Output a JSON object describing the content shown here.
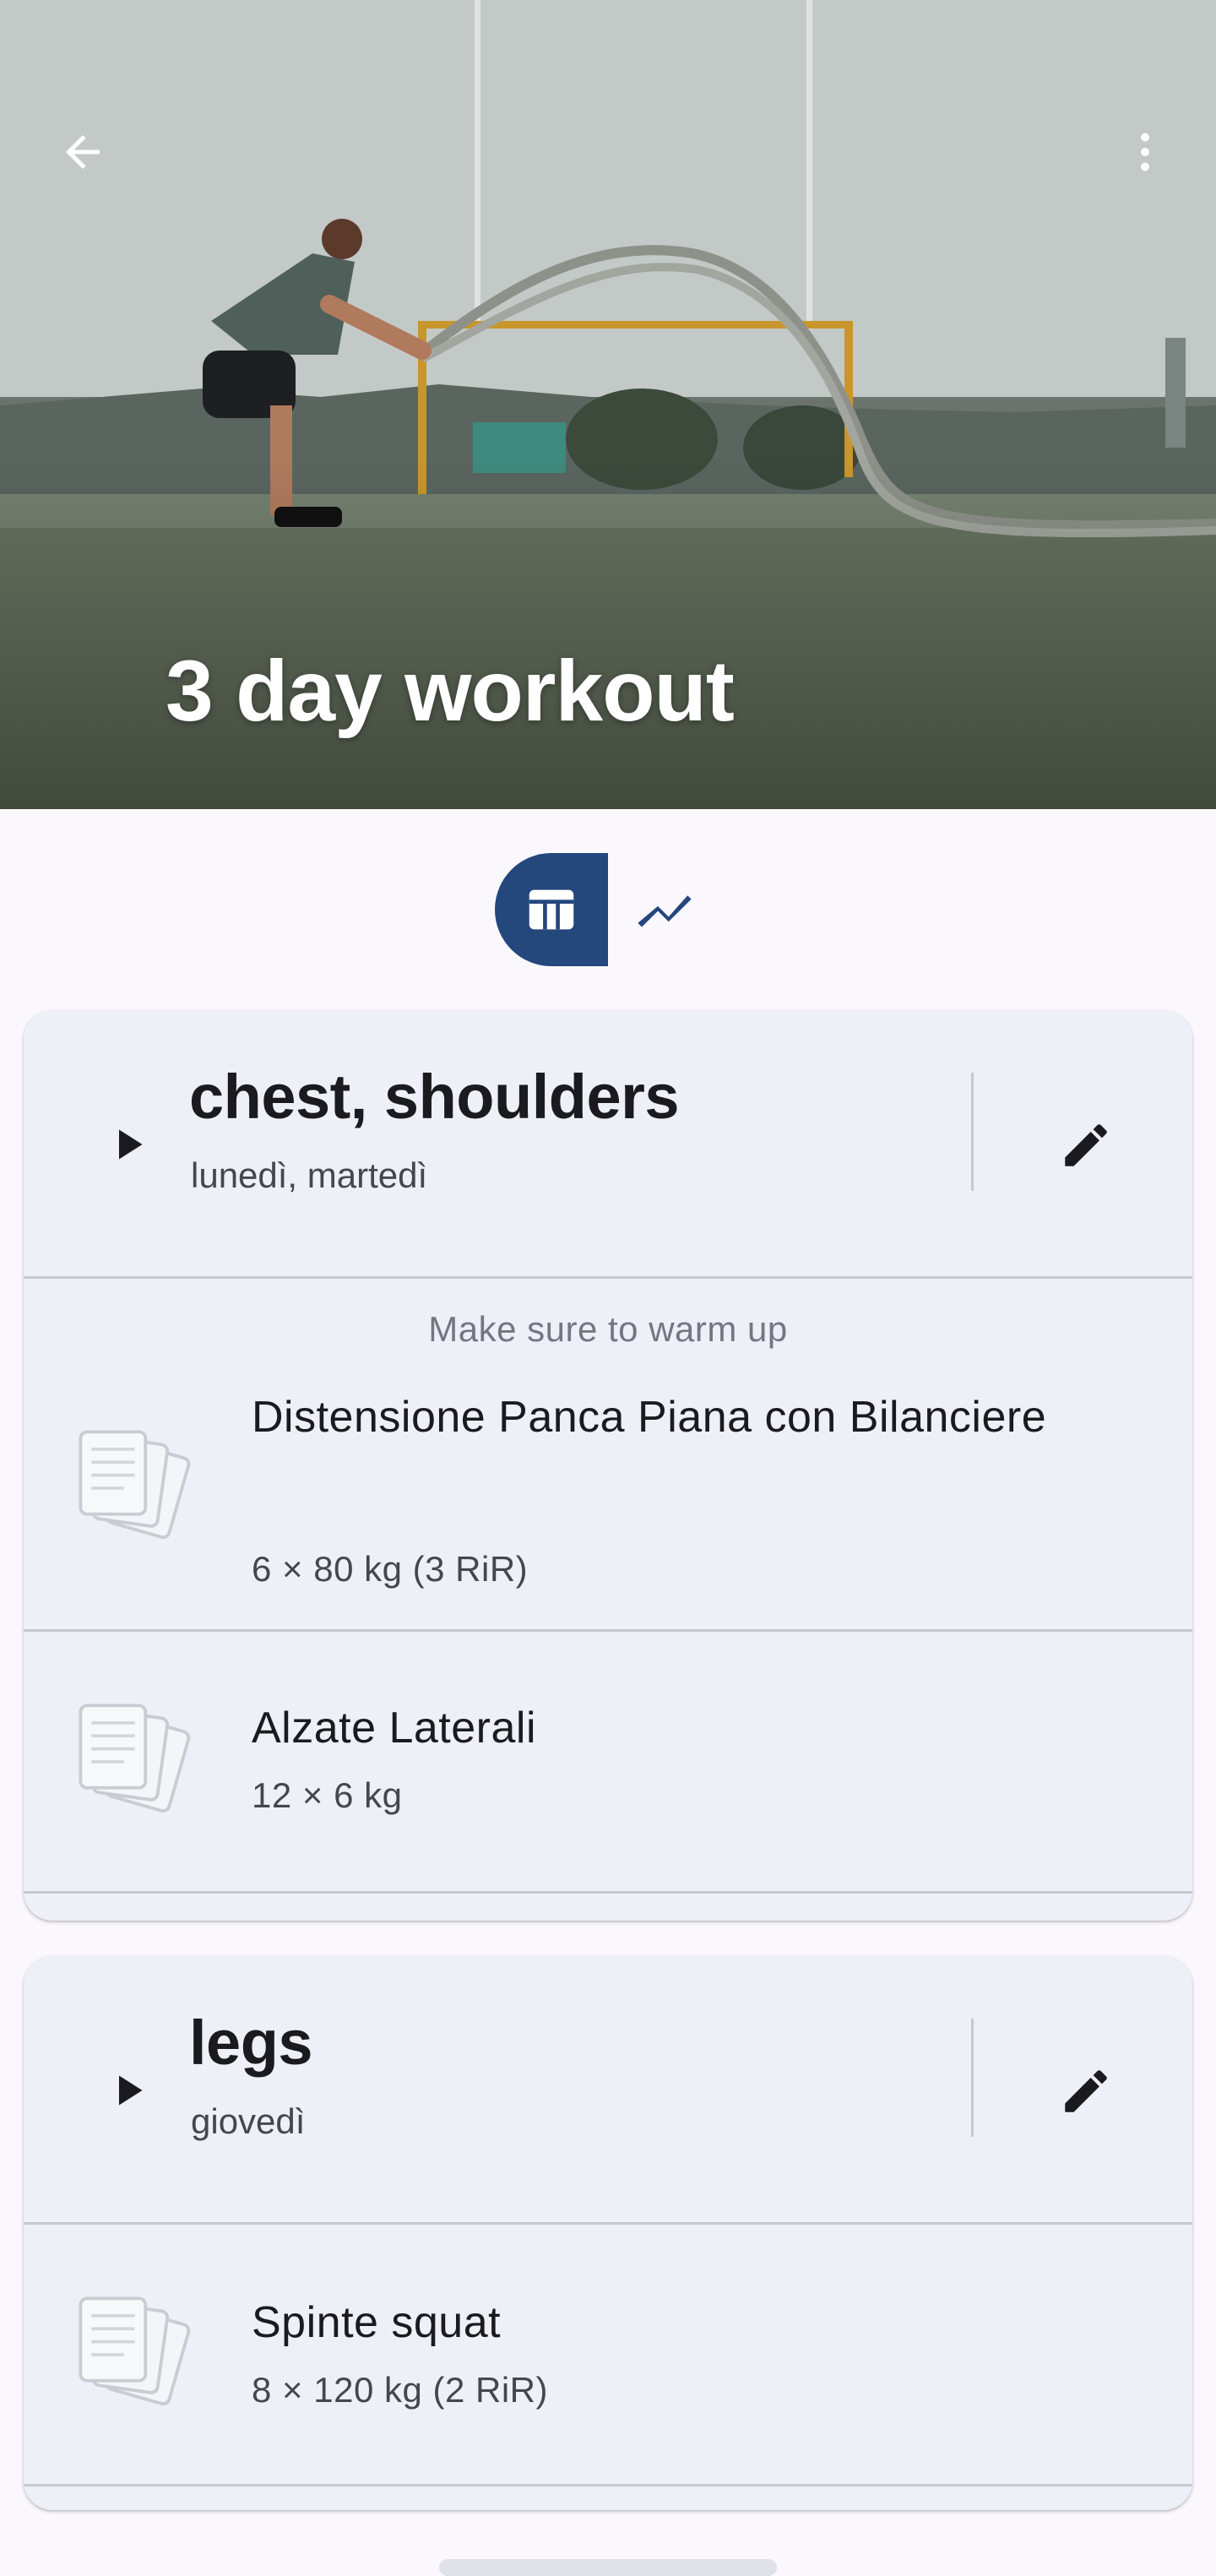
{
  "header": {
    "title": "3 day workout"
  },
  "view_toggle": {
    "active": "table"
  },
  "days": [
    {
      "title": "chest, shoulders",
      "days_label": "lunedì, martedì",
      "note": "Make sure to warm up",
      "exercises": [
        {
          "name": "Distensione Panca Piana con Bilanciere",
          "detail": "6 × 80 kg  (3 RiR)"
        },
        {
          "name": "Alzate Laterali",
          "detail": "12 × 6 kg"
        }
      ]
    },
    {
      "title": "legs",
      "days_label": "giovedì",
      "exercises": [
        {
          "name": "Spinte squat",
          "detail": "8 × 120 kg  (2 RiR)"
        }
      ]
    }
  ],
  "colors": {
    "accent": "#24477c",
    "card_bg": "#edf0f6",
    "background": "#fbf8fd"
  }
}
